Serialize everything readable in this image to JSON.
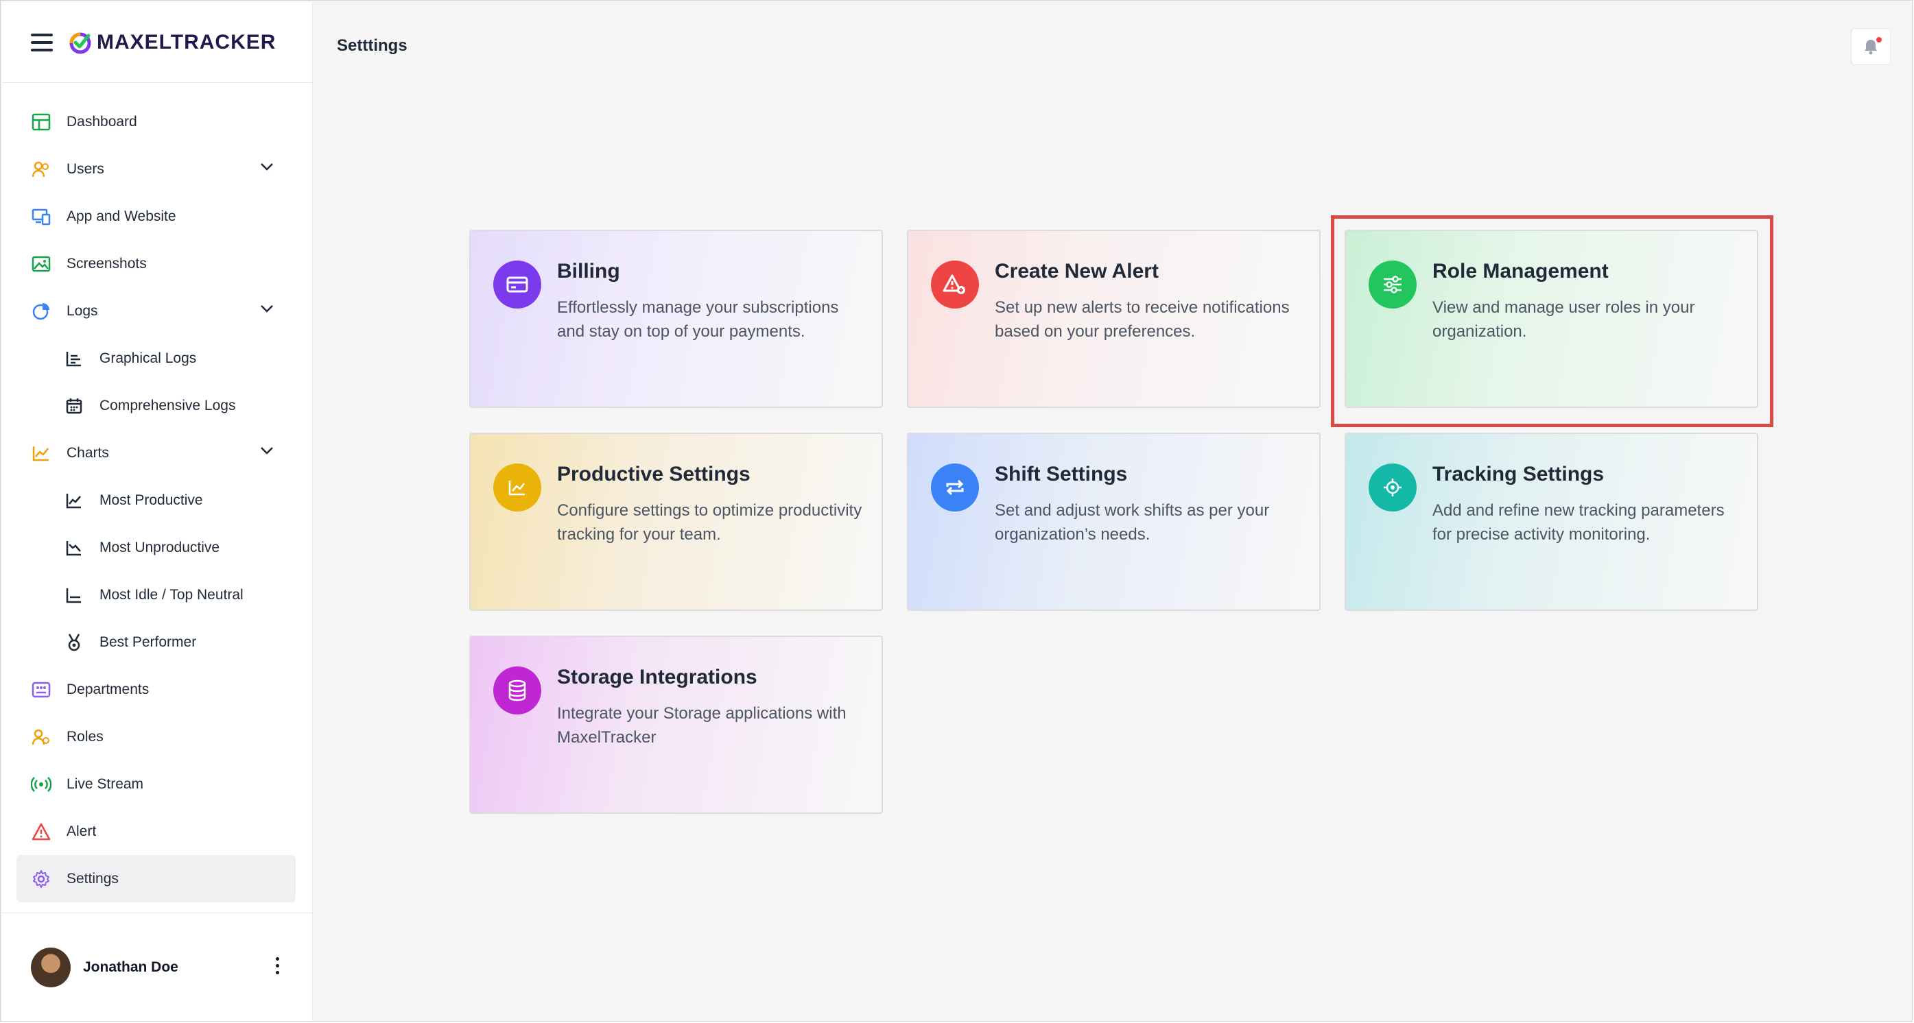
{
  "brand": {
    "name": "MAXELTRACKER"
  },
  "sidebar": {
    "items": [
      {
        "label": "Dashboard"
      },
      {
        "label": "Users"
      },
      {
        "label": "App and Website"
      },
      {
        "label": "Screenshots"
      },
      {
        "label": "Logs"
      },
      {
        "label": "Graphical Logs"
      },
      {
        "label": "Comprehensive Logs"
      },
      {
        "label": "Charts"
      },
      {
        "label": "Most Productive"
      },
      {
        "label": "Most Unproductive"
      },
      {
        "label": "Most Idle / Top Neutral"
      },
      {
        "label": "Best Performer"
      },
      {
        "label": "Departments"
      },
      {
        "label": "Roles"
      },
      {
        "label": "Live Stream"
      },
      {
        "label": "Alert"
      },
      {
        "label": "Settings"
      }
    ],
    "active": "Settings"
  },
  "user": {
    "name": "Jonathan Doe"
  },
  "header": {
    "title": "Setttings"
  },
  "cards": [
    {
      "title": "Billing",
      "description": "Effortlessly manage your subscriptions and stay on top of your payments.",
      "icon": "credit-card-icon",
      "color": "#7c3aed"
    },
    {
      "title": "Create New Alert",
      "description": "Set up new alerts to receive notifications based on your preferences.",
      "icon": "alert-add-icon",
      "color": "#ef4444"
    },
    {
      "title": "Role Management",
      "description": "View and manage user roles in your organization.",
      "icon": "sliders-icon",
      "color": "#22c55e"
    },
    {
      "title": "Productive Settings",
      "description": "Configure settings to optimize productivity tracking for your team.",
      "icon": "chart-line-icon",
      "color": "#eab308"
    },
    {
      "title": "Shift Settings",
      "description": "Set and adjust work shifts as per your organization’s needs.",
      "icon": "repeat-icon",
      "color": "#3b82f6"
    },
    {
      "title": "Tracking Settings",
      "description": "Add and refine new tracking parameters for precise activity monitoring.",
      "icon": "target-icon",
      "color": "#14b8a6"
    },
    {
      "title": "Storage Integrations",
      "description": "Integrate your Storage applications with MaxelTracker",
      "icon": "database-icon",
      "color": "#c026d3"
    }
  ],
  "highlight_color": "#d94a43"
}
